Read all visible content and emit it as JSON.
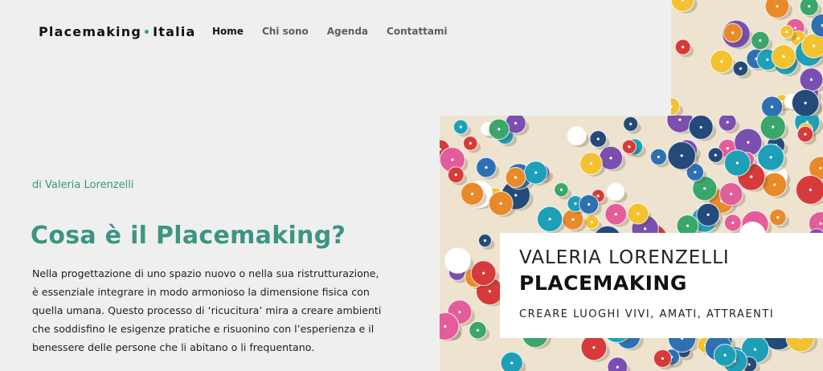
{
  "header": {
    "logo_left": "Placemaking",
    "logo_dot": "•",
    "logo_right": "Italia",
    "nav": [
      {
        "label": "Home",
        "active": true
      },
      {
        "label": "Chi sono",
        "active": false
      },
      {
        "label": "Agenda",
        "active": false
      },
      {
        "label": "Contattami",
        "active": false
      }
    ]
  },
  "hero": {
    "byline": "di Valeria Lorenzelli",
    "title": "Cosa è il Placemaking?",
    "paragraph": "Nella progettazione di uno spazio nuovo o nella sua ristrutturazione, è essenziale integrare in modo armonioso la dimensione fisica con quella umana. Questo processo di ‘ricucitura’ mira a creare ambienti che soddisfino le esigenze pratiche e risuonino con l’esperienza e il benessere delle persone che li abitano o li frequentano."
  },
  "book": {
    "author": "VALERIA LORENZELLI",
    "title": "PLACEMAKING",
    "subtitle": "CREARE LUOGHI VIVI, AMATI, ATTRAENTI"
  },
  "colors": {
    "accent": "#3d9483",
    "background": "#efefef",
    "sand": "#ede3cf",
    "umbrellas": [
      "#d63a3a",
      "#2f6fb3",
      "#f2c230",
      "#3aa66a",
      "#e98a2a",
      "#7a4fb0",
      "#1d9fb8",
      "#e35d9b",
      "#ffffff",
      "#234a7a"
    ]
  }
}
